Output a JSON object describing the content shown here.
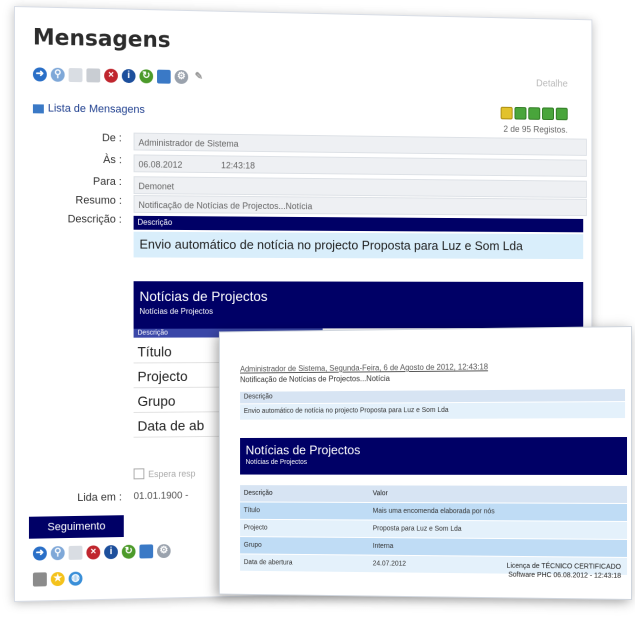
{
  "main": {
    "title": "Mensagens",
    "help": "Detalhe",
    "list_link": "Lista de Mensagens",
    "records": "2 de 95 Registos.",
    "fields": {
      "de_label": "De :",
      "de_value": "Administrador de Sistema",
      "as_label": "Às :",
      "as_date": "06.08.2012",
      "as_time": "12:43:18",
      "para_label": "Para :",
      "para_value": "Demonet",
      "resumo_label": "Resumo :",
      "resumo_value": "Notificação de Notícias de Projectos...Notícia",
      "descricao_label": "Descrição :"
    },
    "preview": {
      "desc_header": "Descrição",
      "desc_text": "Envio automático de notícia no projecto Proposta para Luz e Som Lda",
      "section_title": "Notícias de Projectos",
      "section_sub": "Notícias de Projectos",
      "col_header": "Descrição",
      "rows": [
        "Título",
        "Projecto",
        "Grupo",
        "Data de ab"
      ]
    },
    "checkbox": "Espera resp",
    "lida_label": "Lida em :",
    "lida_value": "01.01.1900 -",
    "seg_button": "Seguimento"
  },
  "email": {
    "header": "Administrador de Sistema, Segunda-Feira, 6 de Agosto de 2012, 12:43:18",
    "subject": "Notificação de Notícias de Projectos...Notícia",
    "desc_header": "Descrição",
    "desc_text": "Envio automático de notícia no projecto Proposta para Luz e Som Lda",
    "section_title": "Notícias de Projectos",
    "section_sub": "Notícias de Projectos",
    "table": {
      "headers": [
        "Descrição",
        "Valor"
      ],
      "rows": [
        [
          "Título",
          "Mais uma encomenda elaborada por nós"
        ],
        [
          "Projecto",
          "Proposta para Luz e Som Lda"
        ],
        [
          "Grupo",
          "Interna"
        ],
        [
          "Data de abertura",
          "24.07.2012"
        ]
      ]
    },
    "license_1": "Licença de TÉCNICO CERTIFICADO",
    "license_2": "Software PHC 06.08.2012 - 12:43:18"
  },
  "colors": {
    "accent": "#000066",
    "light_blue": "#d9eefb",
    "field_bg": "#eef0f3"
  },
  "icons": [
    "arrow-icon",
    "search-icon",
    "document-icon",
    "copy-icon",
    "delete-icon",
    "info-icon",
    "refresh-icon",
    "grid-icon",
    "tools-icon",
    "pen-icon",
    "star-icon",
    "globe-icon",
    "mail-icon"
  ]
}
